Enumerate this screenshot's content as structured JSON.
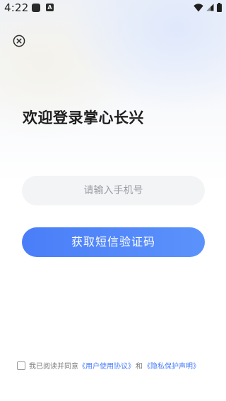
{
  "status_bar": {
    "time": "4:22",
    "app_icon_label": "A"
  },
  "login": {
    "title": "欢迎登录掌心长兴",
    "phone_placeholder": "请输入手机号",
    "phone_value": "",
    "sms_button_label": "获取短信验证码",
    "agreement": {
      "checked": false,
      "prefix": "我已阅读并同意",
      "user_agreement": "《用户使用协议》",
      "and": "和",
      "privacy_statement": "《隐私保护声明》"
    }
  },
  "colors": {
    "accent": "#4a7ef9",
    "input_bg": "#f3f4f6",
    "title_text": "#1e1e1e"
  },
  "icons": {
    "close": "close-circle-icon",
    "wifi": "wifi-icon",
    "signal": "signal-icon",
    "battery": "battery-icon"
  }
}
